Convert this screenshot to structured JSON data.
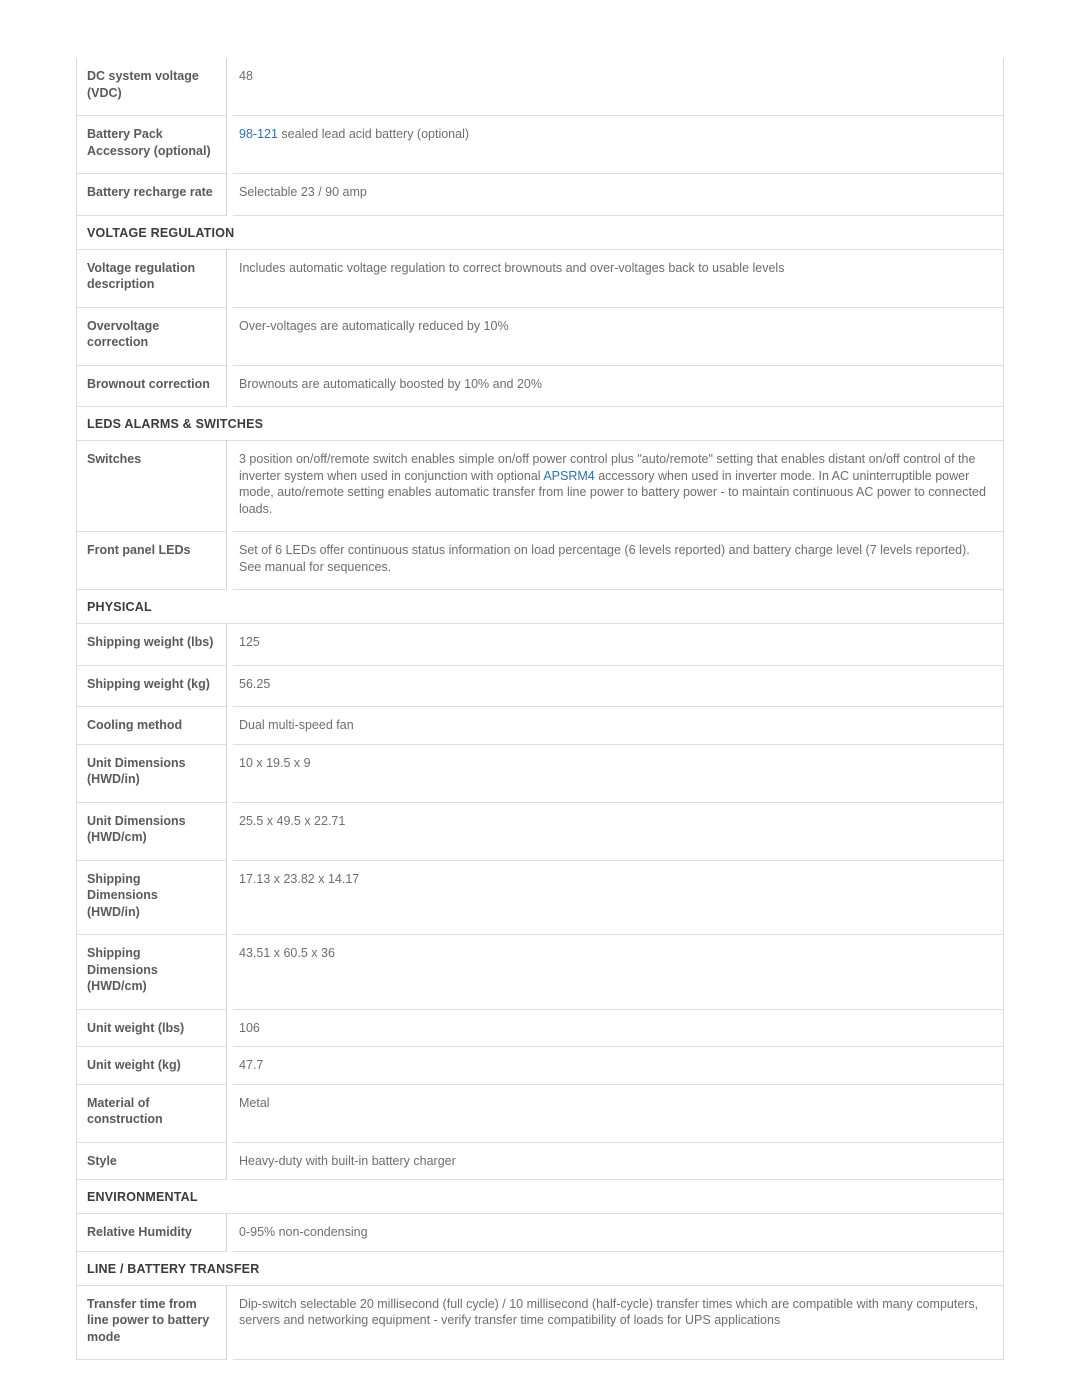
{
  "colors": {
    "link": "#2a6ebb",
    "label_text": "#5a5a5a",
    "value_text": "#6e6e6e",
    "header_text": "#3b3b3b",
    "border": "#dcdcdc"
  },
  "sections": [
    {
      "header": null,
      "rows": [
        {
          "label": "DC system voltage (VDC)",
          "value": "48",
          "tall": true
        },
        {
          "label": "Battery Pack Accessory (optional)",
          "link": "98-121",
          "value": " sealed lead acid battery (optional)",
          "tall": true
        },
        {
          "label": "Battery recharge rate",
          "value": "Selectable 23 / 90 amp",
          "tall": true
        }
      ]
    },
    {
      "header": "VOLTAGE REGULATION",
      "rows": [
        {
          "label": "Voltage regulation description",
          "value": "Includes automatic voltage regulation to correct brownouts and over-voltages back to usable levels",
          "tall": true
        },
        {
          "label": "Overvoltage correction",
          "value": "Over-voltages are automatically reduced by 10%",
          "tall": true
        },
        {
          "label": "Brownout correction",
          "value": "Brownouts are automatically boosted by 10% and 20%",
          "tall": true
        }
      ]
    },
    {
      "header": "LEDS ALARMS & SWITCHES",
      "rows": [
        {
          "label": "Switches",
          "value_before": "3 position on/off/remote switch enables simple on/off power control plus \"auto/remote\" setting that enables distant on/off control of the inverter system when used in conjunction with optional ",
          "link": "APSRM4",
          "value_after": " accessory when used in inverter mode. In AC uninterruptible power mode, auto/remote setting enables automatic transfer from line power to battery power - to maintain continuous AC power to connected loads.",
          "tall": true
        },
        {
          "label": "Front panel LEDs",
          "value": "Set of 6 LEDs offer continuous status information on load percentage (6 levels reported) and battery charge level (7 levels reported). See manual for sequences.",
          "tall": true
        }
      ]
    },
    {
      "header": "PHYSICAL",
      "rows": [
        {
          "label": "Shipping weight (lbs)",
          "value": "125",
          "tall": true
        },
        {
          "label": "Shipping weight (kg)",
          "value": "56.25",
          "tall": true
        },
        {
          "label": "Cooling method",
          "value": "Dual multi-speed fan",
          "tall": false
        },
        {
          "label": "Unit Dimensions (HWD/in)",
          "value": "10 x 19.5 x 9",
          "tall": true
        },
        {
          "label": "Unit Dimensions (HWD/cm)",
          "value": "25.5 x 49.5 x 22.71",
          "tall": true
        },
        {
          "label": "Shipping Dimensions (HWD/in)",
          "value": "17.13 x 23.82 x 14.17",
          "tall": true
        },
        {
          "label": "Shipping Dimensions (HWD/cm)",
          "value": "43.51 x 60.5 x 36",
          "tall": true
        },
        {
          "label": "Unit weight (lbs)",
          "value": "106",
          "tall": false
        },
        {
          "label": "Unit weight (kg)",
          "value": "47.7",
          "tall": false
        },
        {
          "label": "Material of construction",
          "value": "Metal",
          "tall": true
        },
        {
          "label": "Style",
          "value": "Heavy-duty with built-in battery charger",
          "tall": false
        }
      ]
    },
    {
      "header": "ENVIRONMENTAL",
      "rows": [
        {
          "label": "Relative Humidity",
          "value": "0-95% non-condensing",
          "tall": false
        }
      ]
    },
    {
      "header": "LINE / BATTERY TRANSFER",
      "rows": [
        {
          "label": "Transfer time from line power to battery mode",
          "value": "Dip-switch selectable 20 millisecond (full cycle) / 10 millisecond (half-cycle) transfer times which are compatible with many computers, servers and networking equipment - verify transfer time compatibility of loads for UPS applications",
          "tall": true
        }
      ]
    }
  ]
}
